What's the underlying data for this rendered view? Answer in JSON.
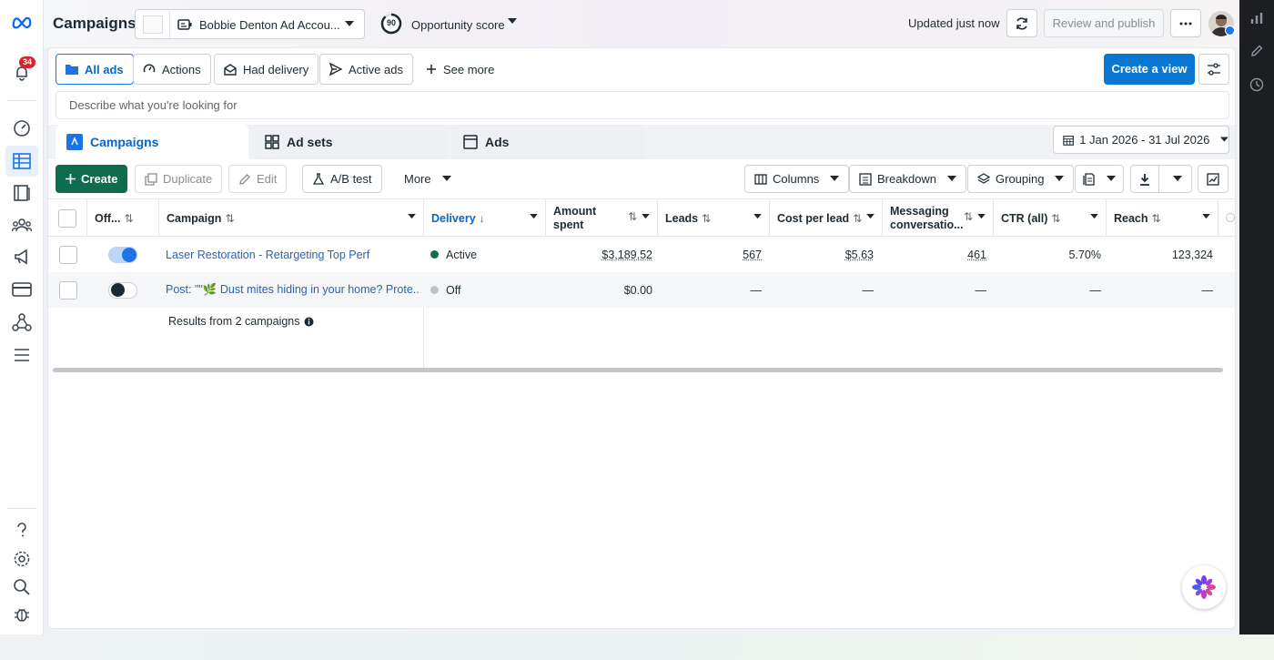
{
  "left_rail": {
    "notification_count": "34",
    "items": [
      {
        "icon": "meta-logo-icon"
      },
      {
        "icon": "notifications-icon"
      },
      {
        "icon": "dashboard-gauge-icon"
      },
      {
        "icon": "campaigns-table-icon"
      },
      {
        "icon": "pages-icon"
      },
      {
        "icon": "audiences-icon"
      },
      {
        "icon": "megaphone-icon"
      },
      {
        "icon": "billing-card-icon"
      },
      {
        "icon": "integrations-icon"
      },
      {
        "icon": "menu-icon"
      },
      {
        "icon": "help-icon"
      },
      {
        "icon": "settings-icon"
      },
      {
        "icon": "search-icon"
      },
      {
        "icon": "bug-icon"
      }
    ]
  },
  "header": {
    "title": "Campaigns",
    "account_name": "Bobbie Denton Ad Accou...",
    "opportunity_score": "90",
    "opportunity_label": "Opportunity score",
    "updated_text": "Updated just now",
    "review_label": "Review and publish"
  },
  "filters": {
    "all_ads": "All ads",
    "actions": "Actions",
    "had_delivery": "Had delivery",
    "active_ads": "Active ads",
    "see_more": "See more",
    "create_view": "Create a view"
  },
  "search": {
    "placeholder": "Describe what you're looking for",
    "value": ""
  },
  "tabs": {
    "campaigns": "Campaigns",
    "ad_sets": "Ad sets",
    "ads": "Ads"
  },
  "date_range": "1 Jan 2026 - 31 Jul 2026",
  "toolbar": {
    "create": "Create",
    "duplicate": "Duplicate",
    "edit": "Edit",
    "ab_test": "A/B test",
    "more": "More",
    "columns": "Columns",
    "breakdown": "Breakdown",
    "grouping": "Grouping"
  },
  "table": {
    "headers": {
      "toggle": "Off...",
      "campaign": "Campaign",
      "delivery": "Delivery",
      "amount_spent_1": "Amount",
      "amount_spent_2": "spent",
      "leads": "Leads",
      "cost_per_lead": "Cost per lead",
      "messaging_1": "Messaging",
      "messaging_2": "conversatio...",
      "ctr": "CTR (all)",
      "reach": "Reach"
    },
    "rows": [
      {
        "on": true,
        "campaign": "Laser Restoration - Retargeting Top Perf",
        "delivery": "Active",
        "delivery_color": "#0b6e4f",
        "amount_spent": "$3,189.52",
        "leads": "567",
        "cost_per_lead": "$5.63",
        "messaging": "461",
        "ctr": "5.70%",
        "reach": "123,324"
      },
      {
        "on": false,
        "campaign": "Post: \"\"🌿 Dust mites hiding in your home? Prote...",
        "delivery": "Off",
        "delivery_color": "#bec3c9",
        "amount_spent": "$0.00",
        "leads": "—",
        "cost_per_lead": "—",
        "messaging": "—",
        "ctr": "—",
        "reach": "—"
      }
    ],
    "summary": "Results from 2 campaigns"
  },
  "colors": {
    "primary": "#0a78d1",
    "create_green": "#106c4e",
    "active_link": "#2a63b8"
  }
}
